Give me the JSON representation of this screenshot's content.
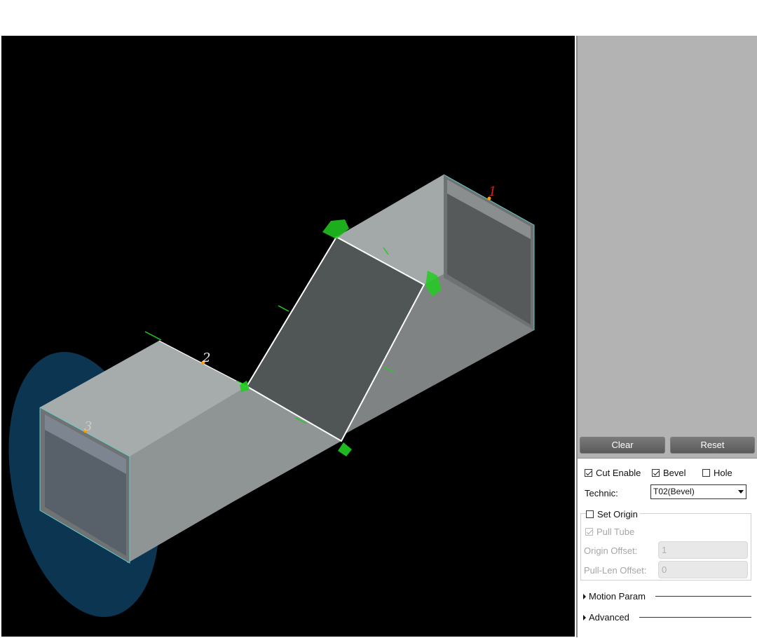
{
  "viewport": {
    "point_labels": [
      "1",
      "2",
      "3"
    ]
  },
  "toolbar": {
    "clear_label": "Clear",
    "reset_label": "Reset"
  },
  "options": {
    "cut_enable": {
      "label": "Cut Enable",
      "checked": true
    },
    "bevel": {
      "label": "Bevel",
      "checked": true
    },
    "hole": {
      "label": "Hole",
      "checked": false
    },
    "technic_label": "Technic:",
    "technic_value": "T02(Bevel)",
    "set_origin": {
      "label": "Set Origin",
      "checked": false
    },
    "pull_tube": {
      "label": "Pull Tube",
      "checked": true,
      "disabled": true
    },
    "origin_offset_label": "Origin Offset:",
    "origin_offset_value": "1",
    "pull_len_offset_label": "Pull-Len Offset:",
    "pull_len_offset_value": "0"
  },
  "sections": {
    "motion_param": "Motion Param",
    "advanced": "Advanced"
  },
  "colors": {
    "viewport_bg": "#000000",
    "tube_face": "#8c9090",
    "cut_edge": "#ffffff",
    "marker_green": "#22cc22",
    "panel_bg": "#b3b3b3",
    "highlight_blue": "#0b3550"
  }
}
